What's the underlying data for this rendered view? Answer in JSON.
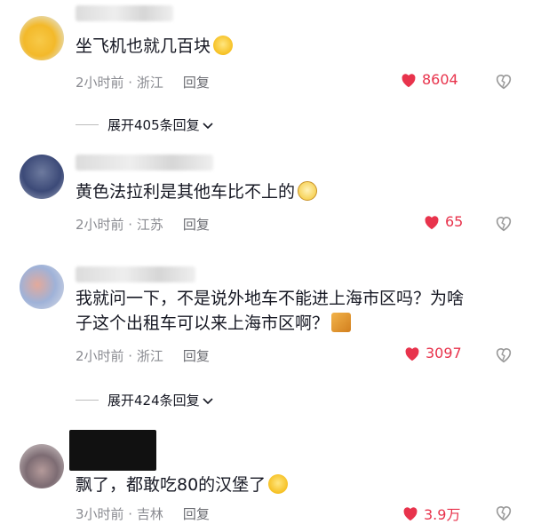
{
  "comments": [
    {
      "text": "坐飞机也就几百块",
      "meta": "2小时前 · 浙江",
      "reply": "回复",
      "likes": "8604",
      "emoji": "grinning-sweat-emoji"
    },
    {
      "text": "黄色法拉利是其他车比不上的",
      "meta": "2小时前 · 江苏",
      "reply": "回复",
      "likes": "65",
      "emoji": "eye-roll-emoji"
    },
    {
      "text_line1": "我就问一下，不是说外地车不能进上海市区吗？为啥",
      "text_line2": "子这个出租车可以来上海市区啊？",
      "meta": "2小时前 · 浙江",
      "reply": "回复",
      "likes": "3097",
      "emoji": "cat-sticker"
    },
    {
      "text": "飘了，都敢吃80的汉堡了",
      "meta": "3小时前 · 吉林",
      "reply": "回复",
      "likes": "3.9万",
      "emoji": "praying-emoji"
    }
  ],
  "expand_1": "展开405条回复",
  "expand_2": "展开424条回复",
  "colors": {
    "like": "#e8334c",
    "meta": "#8a8b91",
    "text": "#161823"
  }
}
